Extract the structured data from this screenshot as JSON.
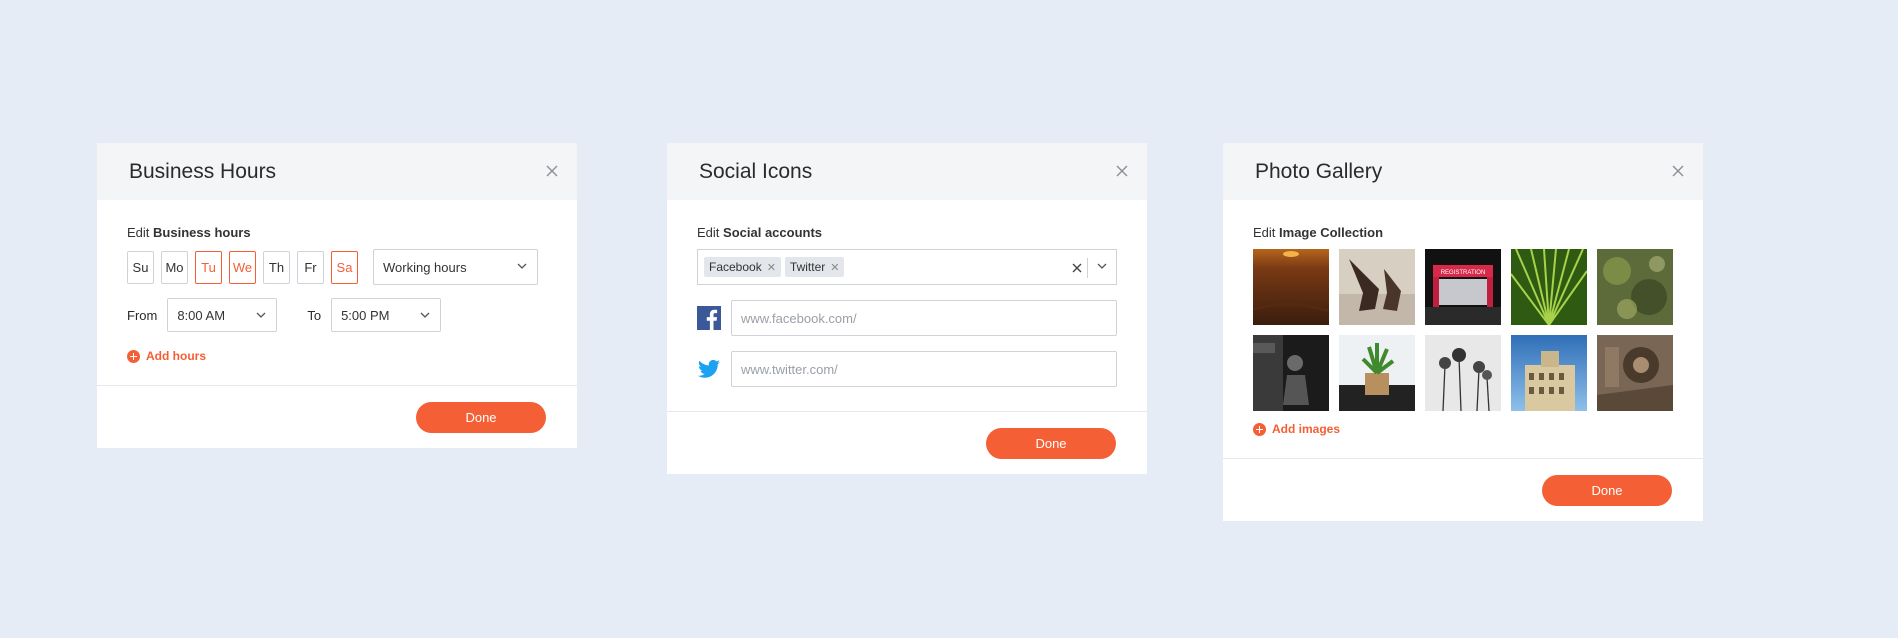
{
  "business": {
    "title": "Business Hours",
    "edit_prefix": "Edit",
    "edit_bold": "Business hours",
    "days": [
      {
        "label": "Su",
        "active": false
      },
      {
        "label": "Mo",
        "active": false
      },
      {
        "label": "Tu",
        "active": true
      },
      {
        "label": "We",
        "active": true
      },
      {
        "label": "Th",
        "active": false
      },
      {
        "label": "Fr",
        "active": false
      },
      {
        "label": "Sa",
        "active": true
      }
    ],
    "mode_select": "Working hours",
    "from_label": "From",
    "from_value": "8:00 AM",
    "to_label": "To",
    "to_value": "5:00 PM",
    "add_label": "Add hours",
    "done_label": "Done"
  },
  "social": {
    "title": "Social Icons",
    "edit_prefix": "Edit",
    "edit_bold": "Social accounts",
    "tags": [
      "Facebook",
      "Twitter"
    ],
    "facebook_placeholder": "www.facebook.com/",
    "twitter_placeholder": "www.twitter.com/",
    "done_label": "Done"
  },
  "gallery": {
    "title": "Photo Gallery",
    "edit_prefix": "Edit",
    "edit_bold": "Image Collection",
    "images": [
      "sunset-beach",
      "boots-legs",
      "registration-entrance",
      "palm-leaf",
      "moss-texture",
      "dark-figure",
      "potted-plant",
      "flowers-bw",
      "city-building",
      "old-machine"
    ],
    "registration_sign": "REGISTRATION",
    "add_label": "Add images",
    "done_label": "Done"
  },
  "colors": {
    "accent": "#f45f35",
    "background": "#e6ecf5",
    "header": "#f4f5f7",
    "facebook": "#3b5998",
    "twitter": "#1da1f2"
  }
}
